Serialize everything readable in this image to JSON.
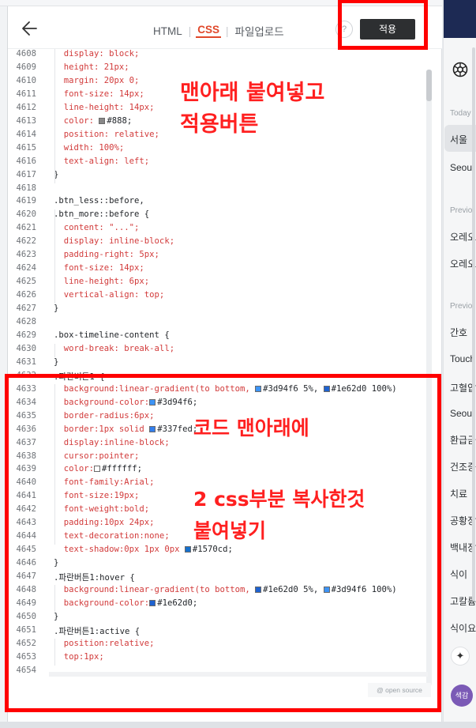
{
  "header": {
    "tabs": [
      {
        "label": "HTML",
        "active": false
      },
      {
        "label": "CSS",
        "active": true
      },
      {
        "label": "파일업로드",
        "active": false
      }
    ],
    "help_label": "?",
    "apply_label": "적용"
  },
  "code": {
    "first_line_number": 4608,
    "lines": [
      {
        "n": "4608",
        "t": "  display: block;"
      },
      {
        "n": "4609",
        "t": "  height: 21px;"
      },
      {
        "n": "4610",
        "t": "  margin: 20px 0;"
      },
      {
        "n": "4611",
        "t": "  font-size: 14px;"
      },
      {
        "n": "4612",
        "t": "  line-height: 14px;"
      },
      {
        "n": "4613",
        "t": "  color: ",
        "sw": "#888888",
        "t2": "#888;"
      },
      {
        "n": "4614",
        "t": "  position: relative;"
      },
      {
        "n": "4615",
        "t": "  width: 100%;"
      },
      {
        "n": "4616",
        "t": "  text-align: left;"
      },
      {
        "n": "4617",
        "t": "}"
      },
      {
        "n": "4618",
        "t": ""
      },
      {
        "n": "4619",
        "t": ".btn_less::before,"
      },
      {
        "n": "4620",
        "t": ".btn_more::before {"
      },
      {
        "n": "4621",
        "t": "  content: \"...\";"
      },
      {
        "n": "4622",
        "t": "  display: inline-block;"
      },
      {
        "n": "4623",
        "t": "  padding-right: 5px;"
      },
      {
        "n": "4624",
        "t": "  font-size: 14px;"
      },
      {
        "n": "4625",
        "t": "  line-height: 6px;"
      },
      {
        "n": "4626",
        "t": "  vertical-align: top;"
      },
      {
        "n": "4627",
        "t": "}"
      },
      {
        "n": "4628",
        "t": ""
      },
      {
        "n": "4629",
        "t": ".box-timeline-content {"
      },
      {
        "n": "4630",
        "t": "  word-break: break-all;"
      },
      {
        "n": "4631",
        "t": "}"
      },
      {
        "n": "4632",
        "t": ".파란버튼1 {"
      },
      {
        "n": "4633",
        "t": "  background:linear-gradient(to bottom, ",
        "sw": "#3d94f6",
        "t2": "#3d94f6 5%, ",
        "sw2": "#1e62d0",
        "t3": "#1e62d0 100%)"
      },
      {
        "n": "4634",
        "t": "  background-color:",
        "sw": "#3d94f6",
        "t2": "#3d94f6;"
      },
      {
        "n": "4635",
        "t": "  border-radius:6px;"
      },
      {
        "n": "4636",
        "t": "  border:1px solid ",
        "sw": "#337fed",
        "t2": "#337fed;"
      },
      {
        "n": "4637",
        "t": "  display:inline-block;"
      },
      {
        "n": "4638",
        "t": "  cursor:pointer;"
      },
      {
        "n": "4639",
        "t": "  color:",
        "sw": "#ffffff",
        "t2": "#ffffff;"
      },
      {
        "n": "4640",
        "t": "  font-family:Arial;"
      },
      {
        "n": "4641",
        "t": "  font-size:19px;"
      },
      {
        "n": "4642",
        "t": "  font-weight:bold;"
      },
      {
        "n": "4643",
        "t": "  padding:10px 24px;"
      },
      {
        "n": "4644",
        "t": "  text-decoration:none;"
      },
      {
        "n": "4645",
        "t": "  text-shadow:0px 1px 0px ",
        "sw": "#1570cd",
        "t2": "#1570cd;"
      },
      {
        "n": "4646",
        "t": "}"
      },
      {
        "n": "4647",
        "t": ".파란버튼1:hover {"
      },
      {
        "n": "4648",
        "t": "  background:linear-gradient(to bottom, ",
        "sw": "#1e62d0",
        "t2": "#1e62d0 5%, ",
        "sw2": "#3d94f6",
        "t3": "#3d94f6 100%)"
      },
      {
        "n": "4649",
        "t": "  background-color:",
        "sw": "#1e62d0",
        "t2": "#1e62d0;"
      },
      {
        "n": "4650",
        "t": "}"
      },
      {
        "n": "4651",
        "t": ".파란버튼1:active {"
      },
      {
        "n": "4652",
        "t": "  position:relative;"
      },
      {
        "n": "4653",
        "t": "  top:1px;"
      },
      {
        "n": "4654",
        "t": ""
      }
    ]
  },
  "annotations": {
    "top": "맨아래 붙여넣고\n적용버튼",
    "middle": "코드 맨아래에",
    "bottom": "2 css부분 복사한것\n붙여넣기"
  },
  "footer": {
    "opensource_label": "@ open source"
  },
  "right_panel": {
    "sections": [
      {
        "label": "Today",
        "items": [
          "서울 ",
          "Seoul"
        ]
      },
      {
        "label": "Previo",
        "items": [
          "오레오",
          "오레오"
        ]
      },
      {
        "label": "Previo",
        "items": [
          "간호 ",
          "Touch",
          "고혈압",
          "Seoul",
          "환급금",
          "건조증",
          "치료 ",
          "공황장",
          "백내장",
          "식이 ",
          "고칼륨",
          "식이요"
        ]
      }
    ],
    "sparkle_icon": "sparkle-icon",
    "avatar_label": "색감"
  },
  "colors": {
    "accent_tab": "#e0482a",
    "annotation_red": "#ff0000",
    "apply_button_bg": "#2d2f31",
    "right_panel_header": "#1d2a54"
  }
}
